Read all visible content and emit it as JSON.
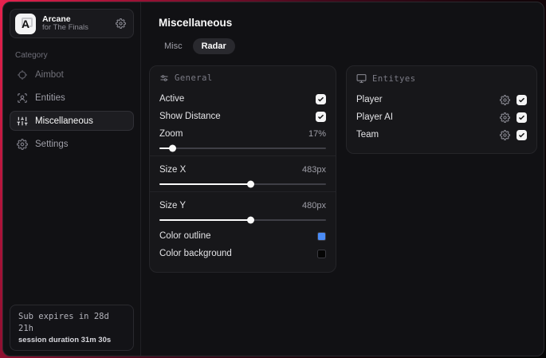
{
  "app": {
    "logo_letter": "A",
    "name": "Arcane",
    "subtitle": "for The Finals"
  },
  "sidebar": {
    "category_label": "Category",
    "items": [
      {
        "label": "Aimbot",
        "icon": "crosshair-icon",
        "active": false
      },
      {
        "label": "Entities",
        "icon": "entities-icon",
        "active": false
      },
      {
        "label": "Miscellaneous",
        "icon": "sliders-icon",
        "active": true
      },
      {
        "label": "Settings",
        "icon": "gear-icon",
        "active": false
      }
    ],
    "footer": {
      "line1": "Sub expires in 28d 21h",
      "line2": "session duration 31m 30s"
    }
  },
  "main": {
    "title": "Miscellaneous",
    "tabs": [
      {
        "label": "Misc",
        "active": false
      },
      {
        "label": "Radar",
        "active": true
      }
    ]
  },
  "general_panel": {
    "header": "General",
    "header_icon": "sliders-horizontal-icon",
    "toggles": [
      {
        "label": "Active",
        "checked": true
      },
      {
        "label": "Show Distance",
        "checked": true
      }
    ],
    "sliders": [
      {
        "label": "Zoom",
        "value": "17%",
        "percent": 8
      },
      {
        "label": "Size X",
        "value": "483px",
        "percent": 55
      },
      {
        "label": "Size Y",
        "value": "480px",
        "percent": 55
      }
    ],
    "colors": [
      {
        "label": "Color outline",
        "hex": "#4a8cf7"
      },
      {
        "label": "Color background",
        "hex": "#050505"
      }
    ]
  },
  "entities_panel": {
    "header": "Entityes",
    "header_icon": "monitor-icon",
    "rows": [
      {
        "label": "Player",
        "checked": true
      },
      {
        "label": "Player AI",
        "checked": true
      },
      {
        "label": "Team",
        "checked": true
      }
    ]
  },
  "icons": {
    "crosshair-icon": "circle with ticks",
    "entities-icon": "user in frame",
    "sliders-icon": "vertical sliders",
    "gear-icon": "cog",
    "sliders-horizontal-icon": "horizontal sliders",
    "monitor-icon": "display with stand",
    "check-icon": "checkmark"
  },
  "theme": {
    "backdrop_red": "#e7224e",
    "window_bg": "#111114",
    "panel_bg": "#17171a",
    "accent_blue": "#4a8cf7"
  }
}
